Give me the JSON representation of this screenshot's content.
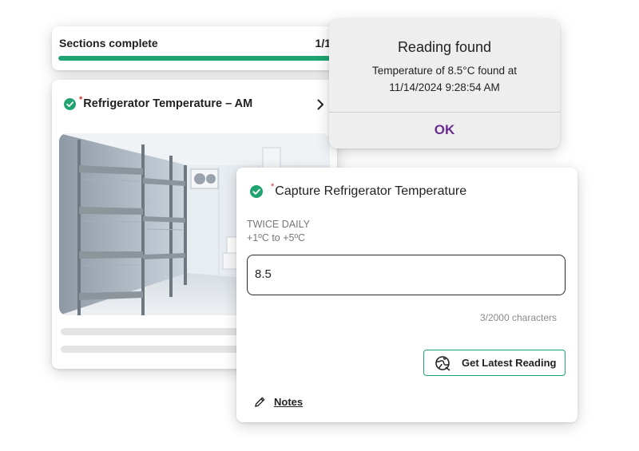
{
  "progress": {
    "title": "Sections complete",
    "count": "1/1",
    "fraction": 1.0,
    "color": "#1fa471"
  },
  "modal": {
    "title": "Reading found",
    "body": "Temperature of 8.5°C found at 11/14/2024 9:28:54 AM",
    "ok_label": "OK",
    "ok_color": "#6b2c91"
  },
  "section": {
    "required_mark": "*",
    "title": "Refrigerator Temperature – AM",
    "status_icon": "check-circle-icon",
    "chevron_icon": "chevron-right-icon",
    "image": "walk-in-refrigerator-shelving-photo"
  },
  "capture": {
    "required_mark": "*",
    "title": "Capture Refrigerator Temperature",
    "frequency": "TWICE DAILY",
    "range": "+1ºC to +5ºC",
    "value": "8.5",
    "char_count": "3/2000 characters",
    "button_label": "Get Latest Reading",
    "button_icon": "sensor-globe-icon",
    "notes_label": "Notes",
    "notes_icon": "pencil-icon",
    "accent": "#1fa471"
  }
}
